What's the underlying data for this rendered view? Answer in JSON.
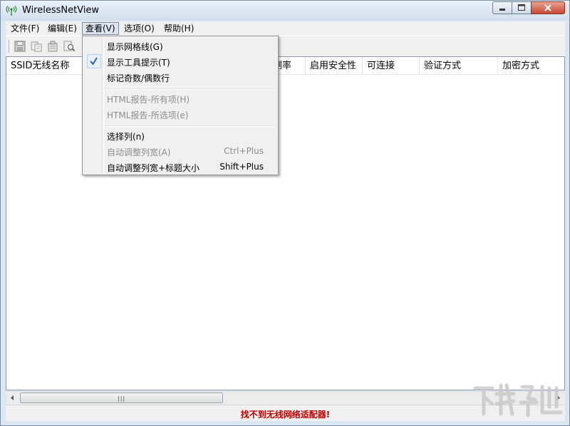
{
  "app": {
    "title": "WirelessNetView"
  },
  "menubar": {
    "items": [
      "文件(F)",
      "编辑(E)",
      "查看(V)",
      "选项(O)",
      "帮助(H)"
    ]
  },
  "columns": [
    "SSID无线名称",
    "测率",
    "启用安全性",
    "可连接",
    "验证方式",
    "加密方式"
  ],
  "view_menu": {
    "show_gridlines": "显示网格线(G)",
    "show_tooltips": "显示工具提示(T)",
    "mark_odd_even": "标记奇数/偶数行",
    "html_report_all": "HTML报告-所有项(H)",
    "html_report_selected": "HTML报告-所选项(e)",
    "choose_columns": "选择列(n)",
    "auto_size": "自动调整列宽(A)",
    "auto_size_shortcut": "Ctrl+Plus",
    "auto_size_headers": "自动调整列宽+标题大小",
    "auto_size_headers_shortcut": "Shift+Plus"
  },
  "status": {
    "message": "找不到无线网络适配器!"
  },
  "colors": {
    "status_error": "#c00000",
    "check_mark": "#1f5fa8"
  }
}
